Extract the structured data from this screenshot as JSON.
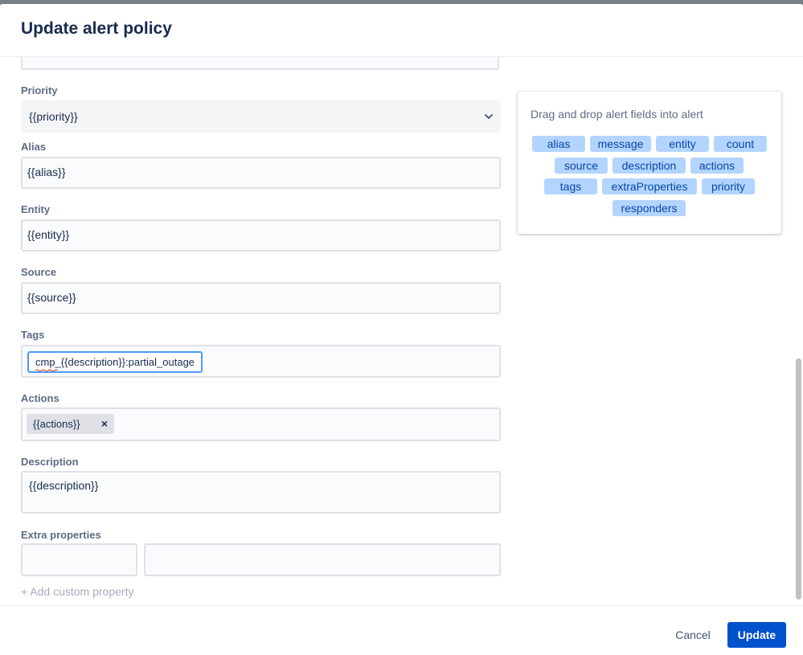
{
  "modal": {
    "title": "Update alert policy"
  },
  "form": {
    "priority": {
      "label": "Priority",
      "value": "{{priority}}"
    },
    "alias": {
      "label": "Alias",
      "value": "{{alias}}"
    },
    "entity": {
      "label": "Entity",
      "value": "{{entity}}"
    },
    "source": {
      "label": "Source",
      "value": "{{source}}"
    },
    "tags": {
      "label": "Tags",
      "value": "cmp_{{description}}:partial_outage"
    },
    "actions": {
      "label": "Actions",
      "items": [
        "{{actions}}"
      ],
      "remove_icon": "close-icon"
    },
    "description": {
      "label": "Description",
      "value": "{{description}}"
    },
    "extra_properties": {
      "label": "Extra properties",
      "key": "",
      "value": ""
    },
    "add_custom_property": "+ Add custom property"
  },
  "fields_panel": {
    "title": "Drag and drop alert fields into alert",
    "fields": [
      "alias",
      "message",
      "entity",
      "count",
      "source",
      "description",
      "actions",
      "tags",
      "extraProperties",
      "priority",
      "responders"
    ]
  },
  "footer": {
    "cancel_label": "Cancel",
    "update_label": "Update"
  },
  "colors": {
    "primary": "#0052cc",
    "field_pill_bg": "#b3d4ff",
    "field_pill_text": "#0747a6",
    "focus_border": "#4c9aff"
  }
}
